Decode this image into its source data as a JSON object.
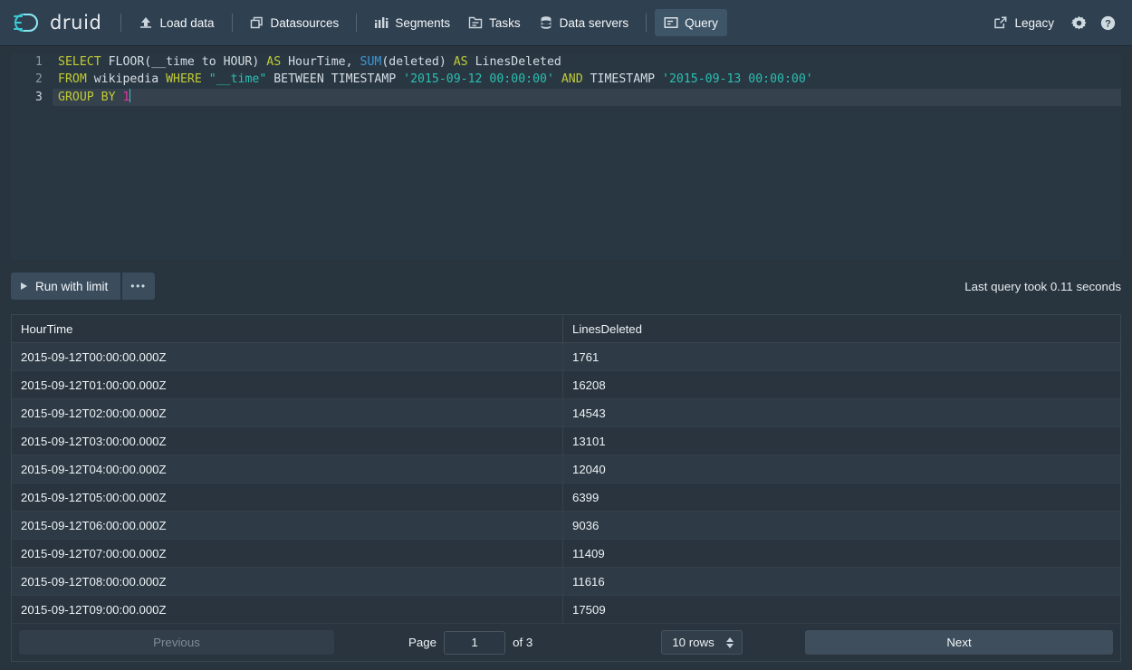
{
  "navbar": {
    "logo_text": "druid",
    "items": [
      {
        "label": "Load data",
        "icon": "upload-icon",
        "active": false
      },
      {
        "label": "Datasources",
        "icon": "datasources-icon",
        "active": false
      },
      {
        "label": "Segments",
        "icon": "segments-icon",
        "active": false
      },
      {
        "label": "Tasks",
        "icon": "tasks-icon",
        "active": false
      },
      {
        "label": "Data servers",
        "icon": "database-icon",
        "active": false
      },
      {
        "label": "Query",
        "icon": "query-icon",
        "active": true
      }
    ],
    "legacy_label": "Legacy",
    "settings_icon": "gear-icon",
    "help_icon": "help-icon",
    "external_link_icon": "external-link-icon"
  },
  "editor": {
    "line_numbers": [
      "1",
      "2",
      "3"
    ],
    "lines": [
      "SELECT FLOOR(__time to HOUR) AS HourTime, SUM(deleted) AS LinesDeleted",
      "FROM wikipedia WHERE \"__time\" BETWEEN TIMESTAMP '2015-09-12 00:00:00' AND TIMESTAMP '2015-09-13 00:00:00'",
      "GROUP BY 1"
    ],
    "active_line": 3
  },
  "toolbar": {
    "run_label": "Run with limit",
    "more_label": "•••",
    "timing_text": "Last query took 0.11 seconds"
  },
  "results": {
    "columns": [
      "HourTime",
      "LinesDeleted"
    ],
    "rows": [
      [
        "2015-09-12T00:00:00.000Z",
        "1761"
      ],
      [
        "2015-09-12T01:00:00.000Z",
        "16208"
      ],
      [
        "2015-09-12T02:00:00.000Z",
        "14543"
      ],
      [
        "2015-09-12T03:00:00.000Z",
        "13101"
      ],
      [
        "2015-09-12T04:00:00.000Z",
        "12040"
      ],
      [
        "2015-09-12T05:00:00.000Z",
        "6399"
      ],
      [
        "2015-09-12T06:00:00.000Z",
        "9036"
      ],
      [
        "2015-09-12T07:00:00.000Z",
        "11409"
      ],
      [
        "2015-09-12T08:00:00.000Z",
        "11616"
      ],
      [
        "2015-09-12T09:00:00.000Z",
        "17509"
      ]
    ]
  },
  "pagination": {
    "previous_label": "Previous",
    "next_label": "Next",
    "page_label": "Page",
    "page_value": "1",
    "of_label": "of 3",
    "rows_per_page": "10 rows"
  },
  "colors": {
    "navbar_bg": "#2f4050",
    "app_bg": "#28343e",
    "editor_bg": "#293742",
    "accent_cyan": "#2bbfb1",
    "keyword": "#c2cc35",
    "function": "#3a9ad9",
    "number": "#e0369c",
    "active_tab": "#3e5467"
  }
}
